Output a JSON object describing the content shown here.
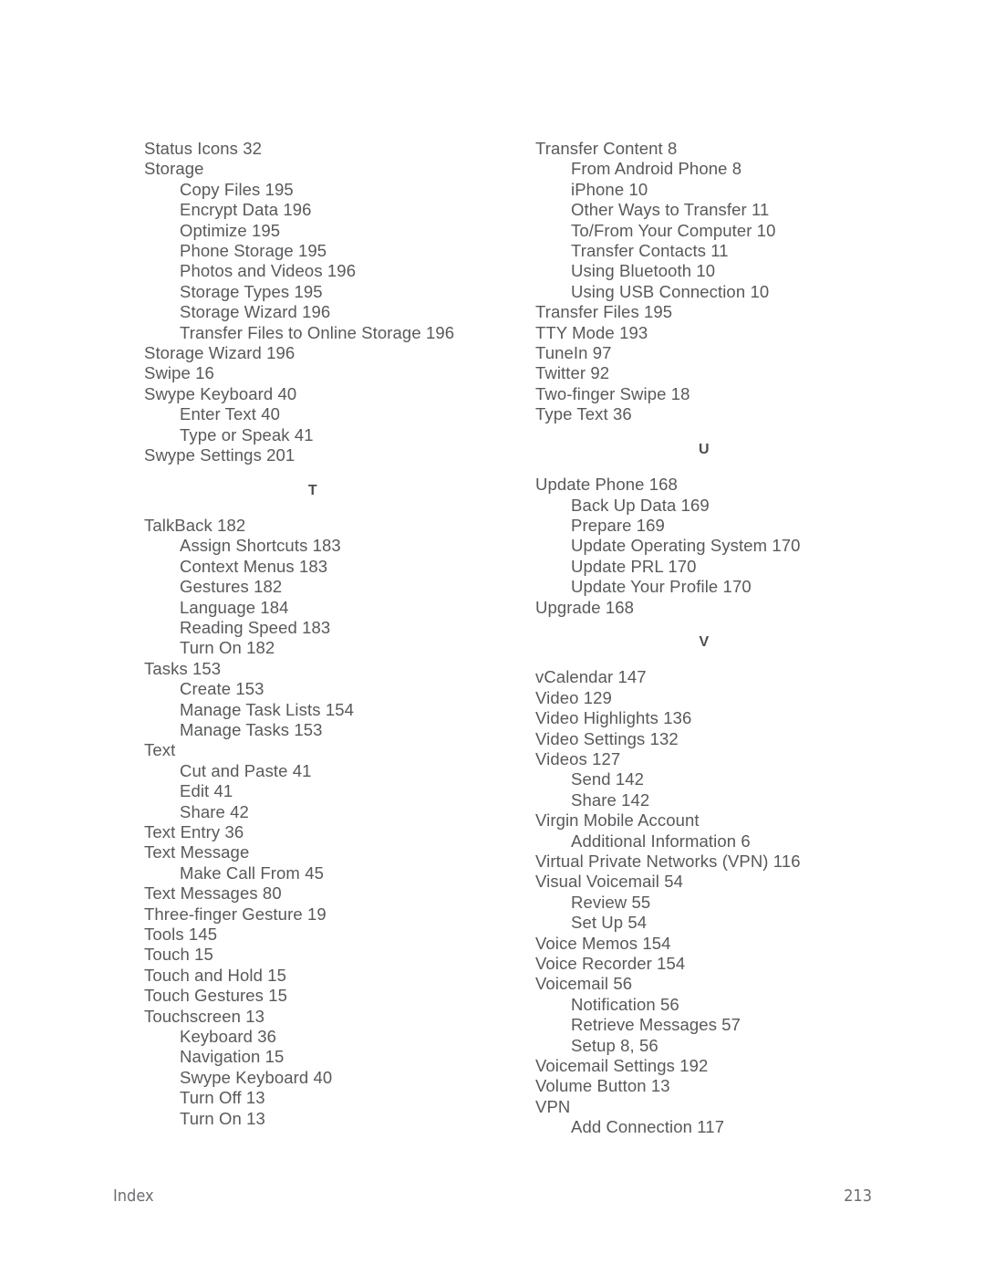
{
  "page": {
    "title": "Index",
    "page_number": "213",
    "text_color": "#58595b",
    "heading_color": "#4d4e50",
    "background": "#ffffff"
  },
  "footer": {
    "label": "Index",
    "page_number": "213"
  },
  "columns": [
    {
      "name": "left-column",
      "blocks": [
        {
          "type": "entries",
          "items": [
            {
              "level": 0,
              "text": "Status Icons  32"
            },
            {
              "level": 0,
              "text": "Storage"
            },
            {
              "level": 1,
              "text": "Copy Files  195"
            },
            {
              "level": 1,
              "text": "Encrypt Data  196"
            },
            {
              "level": 1,
              "text": "Optimize  195"
            },
            {
              "level": 1,
              "text": "Phone Storage  195"
            },
            {
              "level": 1,
              "text": "Photos and Videos  196"
            },
            {
              "level": 1,
              "text": "Storage Types  195"
            },
            {
              "level": 1,
              "text": "Storage Wizard  196"
            },
            {
              "level": 1,
              "text": "Transfer Files to Online Storage  196"
            },
            {
              "level": 0,
              "text": "Storage Wizard  196"
            },
            {
              "level": 0,
              "text": "Swipe  16"
            },
            {
              "level": 0,
              "text": "Swype Keyboard  40"
            },
            {
              "level": 1,
              "text": "Enter Text  40"
            },
            {
              "level": 1,
              "text": "Type or Speak  41"
            },
            {
              "level": 0,
              "text": "Swype Settings  201"
            }
          ]
        },
        {
          "type": "letter",
          "letter": "T"
        },
        {
          "type": "entries",
          "items": [
            {
              "level": 0,
              "text": "TalkBack  182"
            },
            {
              "level": 1,
              "text": "Assign Shortcuts  183"
            },
            {
              "level": 1,
              "text": "Context Menus  183"
            },
            {
              "level": 1,
              "text": "Gestures  182"
            },
            {
              "level": 1,
              "text": "Language  184"
            },
            {
              "level": 1,
              "text": "Reading Speed  183"
            },
            {
              "level": 1,
              "text": "Turn On  182"
            },
            {
              "level": 0,
              "text": "Tasks  153"
            },
            {
              "level": 1,
              "text": "Create  153"
            },
            {
              "level": 1,
              "text": "Manage Task Lists  154"
            },
            {
              "level": 1,
              "text": "Manage Tasks  153"
            },
            {
              "level": 0,
              "text": "Text"
            },
            {
              "level": 1,
              "text": "Cut and Paste  41"
            },
            {
              "level": 1,
              "text": "Edit  41"
            },
            {
              "level": 1,
              "text": "Share  42"
            },
            {
              "level": 0,
              "text": "Text Entry  36"
            },
            {
              "level": 0,
              "text": "Text Message"
            },
            {
              "level": 1,
              "text": "Make Call From  45"
            },
            {
              "level": 0,
              "text": "Text Messages  80"
            },
            {
              "level": 0,
              "text": "Three-finger Gesture  19"
            },
            {
              "level": 0,
              "text": "Tools  145"
            },
            {
              "level": 0,
              "text": "Touch  15"
            },
            {
              "level": 0,
              "text": "Touch and Hold  15"
            },
            {
              "level": 0,
              "text": "Touch Gestures  15"
            },
            {
              "level": 0,
              "text": "Touchscreen  13"
            },
            {
              "level": 1,
              "text": "Keyboard  36"
            },
            {
              "level": 1,
              "text": "Navigation  15"
            },
            {
              "level": 1,
              "text": "Swype Keyboard  40"
            },
            {
              "level": 1,
              "text": "Turn Off  13"
            },
            {
              "level": 1,
              "text": "Turn On  13"
            }
          ]
        }
      ]
    },
    {
      "name": "right-column",
      "blocks": [
        {
          "type": "entries",
          "items": [
            {
              "level": 0,
              "text": "Transfer Content  8"
            },
            {
              "level": 1,
              "text": "From Android Phone  8"
            },
            {
              "level": 1,
              "text": "iPhone  10"
            },
            {
              "level": 1,
              "text": "Other Ways to Transfer  11"
            },
            {
              "level": 1,
              "text": "To/From Your Computer  10"
            },
            {
              "level": 1,
              "text": "Transfer Contacts  11"
            },
            {
              "level": 1,
              "text": "Using Bluetooth  10"
            },
            {
              "level": 1,
              "text": "Using USB Connection  10"
            },
            {
              "level": 0,
              "text": "Transfer Files  195"
            },
            {
              "level": 0,
              "text": "TTY Mode  193"
            },
            {
              "level": 0,
              "text": "TuneIn  97"
            },
            {
              "level": 0,
              "text": "Twitter  92"
            },
            {
              "level": 0,
              "text": "Two-finger Swipe  18"
            },
            {
              "level": 0,
              "text": "Type Text  36"
            }
          ]
        },
        {
          "type": "letter",
          "letter": "U"
        },
        {
          "type": "entries",
          "items": [
            {
              "level": 0,
              "text": "Update Phone  168"
            },
            {
              "level": 1,
              "text": "Back Up Data  169"
            },
            {
              "level": 1,
              "text": "Prepare  169"
            },
            {
              "level": 1,
              "text": "Update Operating System  170"
            },
            {
              "level": 1,
              "text": "Update PRL  170"
            },
            {
              "level": 1,
              "text": "Update Your Profile  170"
            },
            {
              "level": 0,
              "text": "Upgrade  168"
            }
          ]
        },
        {
          "type": "letter",
          "letter": "V"
        },
        {
          "type": "entries",
          "items": [
            {
              "level": 0,
              "text": "vCalendar  147"
            },
            {
              "level": 0,
              "text": "Video  129"
            },
            {
              "level": 0,
              "text": "Video Highlights  136"
            },
            {
              "level": 0,
              "text": "Video Settings  132"
            },
            {
              "level": 0,
              "text": "Videos  127"
            },
            {
              "level": 1,
              "text": "Send  142"
            },
            {
              "level": 1,
              "text": "Share  142"
            },
            {
              "level": 0,
              "text": "Virgin Mobile Account"
            },
            {
              "level": 1,
              "text": "Additional Information  6"
            },
            {
              "level": 0,
              "text": "Virtual Private Networks (VPN)  116"
            },
            {
              "level": 0,
              "text": "Visual Voicemail  54"
            },
            {
              "level": 1,
              "text": "Review  55"
            },
            {
              "level": 1,
              "text": "Set Up  54"
            },
            {
              "level": 0,
              "text": "Voice Memos  154"
            },
            {
              "level": 0,
              "text": "Voice Recorder  154"
            },
            {
              "level": 0,
              "text": "Voicemail  56"
            },
            {
              "level": 1,
              "text": "Notification  56"
            },
            {
              "level": 1,
              "text": "Retrieve Messages  57"
            },
            {
              "level": 1,
              "text": "Setup  8, 56"
            },
            {
              "level": 0,
              "text": "Voicemail Settings  192"
            },
            {
              "level": 0,
              "text": "Volume Button  13"
            },
            {
              "level": 0,
              "text": "VPN"
            },
            {
              "level": 1,
              "text": "Add Connection  117"
            }
          ]
        }
      ]
    }
  ]
}
